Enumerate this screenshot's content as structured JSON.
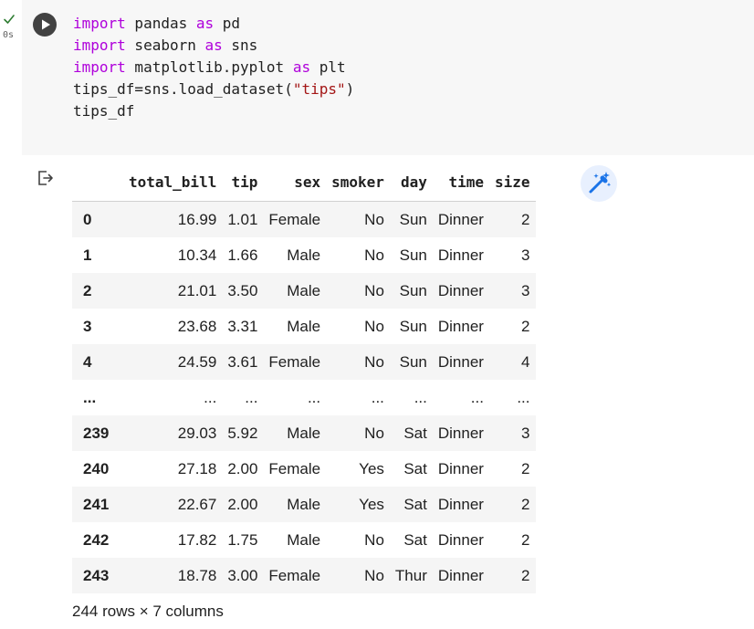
{
  "cell": {
    "run_time": "0s",
    "code": [
      [
        {
          "t": "import",
          "k": "kw"
        },
        {
          "t": " pandas "
        },
        {
          "t": "as",
          "k": "kw"
        },
        {
          "t": " pd"
        }
      ],
      [
        {
          "t": "import",
          "k": "kw"
        },
        {
          "t": " seaborn "
        },
        {
          "t": "as",
          "k": "kw"
        },
        {
          "t": " sns"
        }
      ],
      [
        {
          "t": "import",
          "k": "kw"
        },
        {
          "t": " matplotlib.pyplot "
        },
        {
          "t": "as",
          "k": "kw"
        },
        {
          "t": " plt"
        }
      ],
      [
        {
          "t": "tips_df=sns.load_dataset("
        },
        {
          "t": "\"tips\"",
          "k": "str"
        },
        {
          "t": ")"
        }
      ],
      [
        {
          "t": "tips_df"
        }
      ]
    ]
  },
  "icons": {
    "status": "check-icon",
    "run": "play-icon",
    "output": "output-redirect-icon",
    "magic": "magic-wand-icon"
  },
  "colors": {
    "check": "#2e7d32",
    "run_button": "#424242",
    "keyword": "#af00db",
    "string": "#a31515",
    "magic_bg": "#e8f0fe",
    "magic_fg": "#1a73e8"
  },
  "dataframe": {
    "columns": [
      "total_bill",
      "tip",
      "sex",
      "smoker",
      "day",
      "time",
      "size"
    ],
    "rows": [
      {
        "index": "0",
        "cells": [
          "16.99",
          "1.01",
          "Female",
          "No",
          "Sun",
          "Dinner",
          "2"
        ]
      },
      {
        "index": "1",
        "cells": [
          "10.34",
          "1.66",
          "Male",
          "No",
          "Sun",
          "Dinner",
          "3"
        ]
      },
      {
        "index": "2",
        "cells": [
          "21.01",
          "3.50",
          "Male",
          "No",
          "Sun",
          "Dinner",
          "3"
        ]
      },
      {
        "index": "3",
        "cells": [
          "23.68",
          "3.31",
          "Male",
          "No",
          "Sun",
          "Dinner",
          "2"
        ]
      },
      {
        "index": "4",
        "cells": [
          "24.59",
          "3.61",
          "Female",
          "No",
          "Sun",
          "Dinner",
          "4"
        ]
      },
      {
        "index": "...",
        "cells": [
          "...",
          "...",
          "...",
          "...",
          "...",
          "...",
          "..."
        ]
      },
      {
        "index": "239",
        "cells": [
          "29.03",
          "5.92",
          "Male",
          "No",
          "Sat",
          "Dinner",
          "3"
        ]
      },
      {
        "index": "240",
        "cells": [
          "27.18",
          "2.00",
          "Female",
          "Yes",
          "Sat",
          "Dinner",
          "2"
        ]
      },
      {
        "index": "241",
        "cells": [
          "22.67",
          "2.00",
          "Male",
          "Yes",
          "Sat",
          "Dinner",
          "2"
        ]
      },
      {
        "index": "242",
        "cells": [
          "17.82",
          "1.75",
          "Male",
          "No",
          "Sat",
          "Dinner",
          "2"
        ]
      },
      {
        "index": "243",
        "cells": [
          "18.78",
          "3.00",
          "Female",
          "No",
          "Thur",
          "Dinner",
          "2"
        ]
      }
    ],
    "shape": "244 rows × 7 columns"
  }
}
